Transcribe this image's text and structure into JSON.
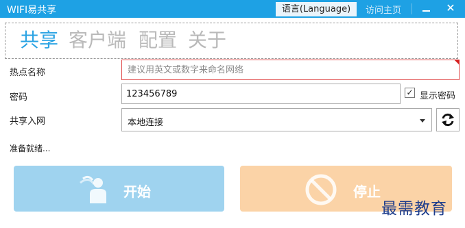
{
  "window": {
    "title": "WIFI易共享",
    "language_button": "语言(Language)",
    "home_link": "访问主页"
  },
  "tabs": [
    {
      "label": "共享",
      "active": true
    },
    {
      "label": "客户端",
      "active": false
    },
    {
      "label": "配置",
      "active": false
    },
    {
      "label": "关于",
      "active": false
    }
  ],
  "form": {
    "ssid_label": "热点名称",
    "ssid_placeholder": "建议用英文或数字来命名网络",
    "ssid_value": "",
    "password_label": "密码",
    "password_value": "123456789",
    "show_password_label": "显示密码",
    "show_password_checked": true,
    "network_label": "共享入网",
    "network_value": "本地连接"
  },
  "status_text": "准备就绪...",
  "buttons": {
    "start_label": "开始",
    "stop_label": "停止"
  },
  "watermark": "最需教育",
  "colors": {
    "titlebar": "#1ea1e4",
    "active_tab": "#2aa3e3",
    "start_button": "#9fd3ef",
    "stop_button": "#fbd3a7",
    "ssid_border": "#e04848"
  },
  "icons": {
    "refresh": "refresh-icon",
    "start": "wifi-person-icon",
    "stop": "prohibited-icon"
  }
}
